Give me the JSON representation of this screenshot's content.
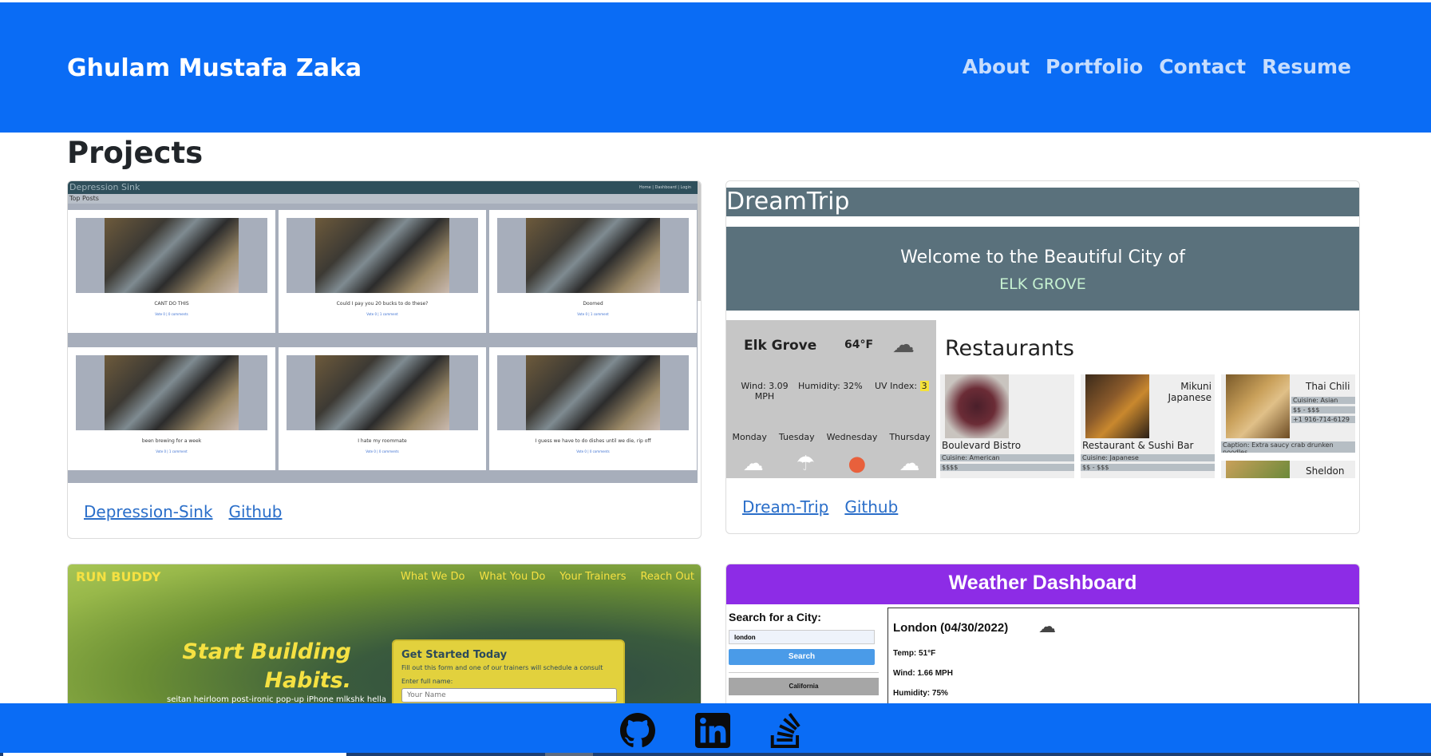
{
  "header": {
    "brand": "Ghulam Mustafa Zaka",
    "nav": [
      "About",
      "Portfolio",
      "Contact",
      "Resume"
    ]
  },
  "main": {
    "title": "Projects",
    "projects": [
      {
        "links": [
          "Depression-Sink",
          "Github"
        ],
        "preview": {
          "app_title": "Depression Sink",
          "nav_text": "Home | Dashboard | Login",
          "subheader": "Top Posts",
          "posts": [
            {
              "caption": "CANT DO THIS",
              "meta": "Vote 0 | 0 comments"
            },
            {
              "caption": "Could I pay you 20 bucks to do these?",
              "meta": "Vote 0 | 1 comment"
            },
            {
              "caption": "Doomed",
              "meta": "Vote 0 | 1 comment"
            },
            {
              "caption": "been brewing for a week",
              "meta": "Vote 0 | 1 comment"
            },
            {
              "caption": "I hate my roommate",
              "meta": "Vote 0 | 0 comments"
            },
            {
              "caption": "I guess we have to do dishes until we die, rip off",
              "meta": "Vote 0 | 0 comments"
            }
          ]
        }
      },
      {
        "links": [
          "Dream-Trip",
          "Github"
        ],
        "preview": {
          "app_title": "DreamTrip",
          "welcome": "Welcome to the Beautiful City of",
          "city_upper": "ELK GROVE",
          "weather_city": "Elk Grove",
          "weather_temp": "64°F",
          "wind": "Wind: 3.09 MPH",
          "humidity": "Humidity: 32%",
          "uv_label": "UV Index:",
          "uv_value": "3",
          "days": [
            "Monday",
            "Tuesday",
            "Wednesday",
            "Thursday"
          ],
          "restaurants_title": "Restaurants",
          "restaurants": [
            {
              "name": "Boulevard Bistro",
              "cuisine": "Cuisine: American",
              "price": "$$$$"
            },
            {
              "name": "Restaurant & Sushi Bar",
              "tag": "Mikuni Japanese",
              "cuisine": "Cuisine: Japanese",
              "price": "$$ - $$$"
            },
            {
              "name": "Thai Chili",
              "cuisine": "Cuisine: Asian",
              "price": "$$ - $$$",
              "phone": "+1 916-714-6129",
              "caption": "Caption: Extra saucy crab drunken noodles"
            },
            {
              "name": "Sheldon"
            }
          ]
        }
      },
      {
        "preview": {
          "logo": "RUN BUDDY",
          "nav": [
            "What We Do",
            "What You Do",
            "Your Trainers",
            "Reach Out"
          ],
          "hero_line1": "Start Building",
          "hero_line2": "Habits.",
          "tagline": "seitan heirloom post-ironic pop-up iPhone mlkshk hella",
          "form_title": "Get Started Today",
          "form_sub": "Fill out this form and one of our trainers will schedule a consult",
          "form_label": "Enter full name:",
          "form_placeholder": "Your Name"
        }
      },
      {
        "preview": {
          "title": "Weather Dashboard",
          "search_label": "Search for a City:",
          "search_value": "london",
          "search_button": "Search",
          "history": [
            "California"
          ],
          "city_date": "London (04/30/2022)",
          "temp": "Temp: 51°F",
          "wind": "Wind: 1.66 MPH",
          "humidity": "Humidity: 75%"
        }
      }
    ]
  },
  "colors": {
    "primary": "#0a6cf5",
    "nav_link": "#c7ddfd",
    "link": "#2a6ec9"
  },
  "footer": {
    "icons": [
      "github-icon",
      "linkedin-icon",
      "stackoverflow-icon"
    ]
  }
}
